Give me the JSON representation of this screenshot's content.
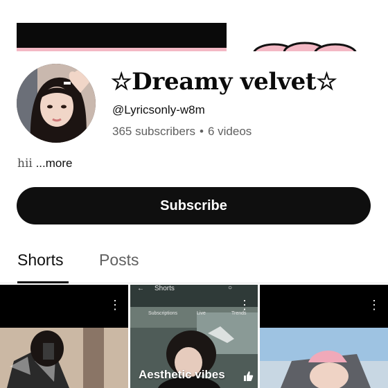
{
  "channel": {
    "name": "☆Dreamy velvet☆",
    "handle": "@Lyricsonly-w8m",
    "subscribers": "365 subscribers",
    "separator": "•",
    "videos": "6 videos",
    "description": "hii",
    "more_label": "...more"
  },
  "actions": {
    "subscribe_label": "Subscribe"
  },
  "tabs": [
    {
      "label": "Shorts",
      "active": true
    },
    {
      "label": "Posts",
      "active": false
    }
  ],
  "shorts": [
    {
      "title": "",
      "menu": "⋮"
    },
    {
      "title": "Aesthetic vibes",
      "menu": "⋮",
      "inner_header": "Shorts",
      "inner_tabs": [
        "Subscriptions",
        "Live",
        "Trends"
      ]
    },
    {
      "title": "",
      "menu": "⋮"
    }
  ],
  "colors": {
    "accent": "#0f0f0f",
    "secondary_text": "#606060",
    "banner_pink": "#f3b8c4"
  },
  "icons": [
    "kebab-menu-icon",
    "thumbs-up-icon",
    "back-arrow-icon",
    "search-icon"
  ]
}
